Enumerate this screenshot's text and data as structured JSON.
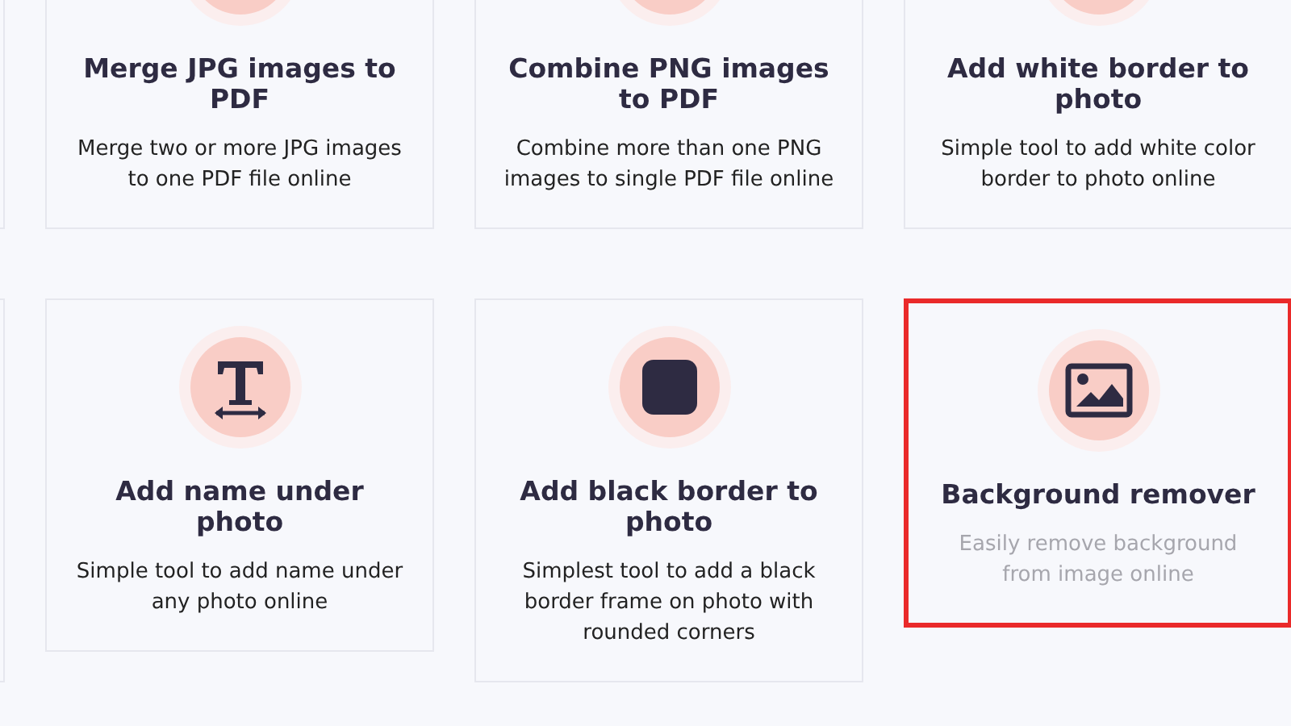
{
  "rows": [
    {
      "cards": [
        {
          "icon": {
            "kind": "hidden"
          },
          "title": "Merge JPG images to PDF",
          "description": "Merge two or more JPG images to one PDF file online",
          "highlighted": false
        },
        {
          "icon": {
            "kind": "hidden"
          },
          "title": "Combine PNG images to PDF",
          "description": "Combine more than one PNG images to single PDF file online",
          "highlighted": false
        },
        {
          "icon": {
            "kind": "hidden"
          },
          "title": "Add white border to photo",
          "description": "Simple tool to add white color border to photo online",
          "highlighted": false
        }
      ]
    },
    {
      "cards": [
        {
          "icon": {
            "kind": "text"
          },
          "title": "Add name under photo",
          "description": "Simple tool to add name under any photo online",
          "highlighted": false
        },
        {
          "icon": {
            "kind": "square"
          },
          "title": "Add black border to photo",
          "description": "Simplest tool to add a black border frame on photo with rounded corners",
          "highlighted": false
        },
        {
          "icon": {
            "kind": "image"
          },
          "title": "Background remover",
          "description": "Easily remove background from image online",
          "highlighted": true
        }
      ]
    }
  ]
}
